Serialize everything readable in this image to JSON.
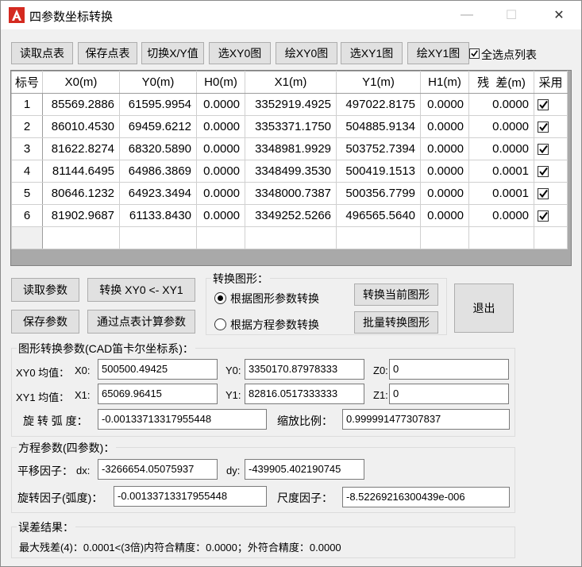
{
  "window": {
    "title": "四参数坐标转换",
    "minimize": "—",
    "maximize": "☐",
    "close": "✕"
  },
  "toolbar": {
    "read_points": "读取点表",
    "save_points": "保存点表",
    "switch_xy": "切换X/Y值",
    "select_xy0": "选XY0图",
    "draw_xy0": "绘XY0图",
    "select_xy1": "选XY1图",
    "draw_xy1": "绘XY1图",
    "select_all_label": "全选点列表",
    "select_all_checked": true
  },
  "table": {
    "columns": [
      "标号",
      "X0(m)",
      "Y0(m)",
      "H0(m)",
      "X1(m)",
      "Y1(m)",
      "H1(m)",
      "残  差(m)",
      "采用"
    ],
    "rows": [
      {
        "id": "1",
        "x0": "85569.2886",
        "y0": "61595.9954",
        "h0": "0.0000",
        "x1": "3352919.4925",
        "y1": "497022.8175",
        "h1": "0.0000",
        "res": "0.0000",
        "use": true
      },
      {
        "id": "2",
        "x0": "86010.4530",
        "y0": "69459.6212",
        "h0": "0.0000",
        "x1": "3353371.1750",
        "y1": "504885.9134",
        "h1": "0.0000",
        "res": "0.0000",
        "use": true
      },
      {
        "id": "3",
        "x0": "81622.8274",
        "y0": "68320.5890",
        "h0": "0.0000",
        "x1": "3348981.9929",
        "y1": "503752.7394",
        "h1": "0.0000",
        "res": "0.0000",
        "use": true
      },
      {
        "id": "4",
        "x0": "81144.6495",
        "y0": "64986.3869",
        "h0": "0.0000",
        "x1": "3348499.3530",
        "y1": "500419.1513",
        "h1": "0.0000",
        "res": "0.0001",
        "use": true
      },
      {
        "id": "5",
        "x0": "80646.1232",
        "y0": "64923.3494",
        "h0": "0.0000",
        "x1": "3348000.7387",
        "y1": "500356.7799",
        "h1": "0.0000",
        "res": "0.0001",
        "use": true
      },
      {
        "id": "6",
        "x0": "81902.9687",
        "y0": "61133.8430",
        "h0": "0.0000",
        "x1": "3349252.5266",
        "y1": "496565.5640",
        "h1": "0.0000",
        "res": "0.0000",
        "use": true
      }
    ]
  },
  "params_buttons": {
    "read_params": "读取参数",
    "convert": "转换 XY0 <- XY1",
    "save_params": "保存参数",
    "calc_params": "通过点表计算参数"
  },
  "convert_shape": {
    "title": "转换图形：",
    "by_shape_params": "根据图形参数转换",
    "by_equation_params": "根据方程参数转换",
    "selected": "by_shape_params",
    "convert_current": "转换当前图形",
    "batch_convert": "批量转换图形"
  },
  "exit": "退出",
  "shape_params": {
    "title": "图形转换参数(CAD笛卡尔坐标系)：",
    "xy0_mean": "XY0 均值：",
    "xy1_mean": "XY1 均值：",
    "x0_label": "X0:",
    "y0_label": "Y0:",
    "z0_label": "Z0:",
    "x1_label": "X1:",
    "y1_label": "Y1:",
    "z1_label": "Z1:",
    "x0": "500500.49425",
    "y0": "3350170.87978333",
    "z0": "0",
    "x1": "65069.96415",
    "y1": "82816.0517333333",
    "z1": "0",
    "rotation_label": "旋 转 弧 度：",
    "rotation": "-0.00133713317955448",
    "scale_label": "缩放比例：",
    "scale": "0.999991477307837"
  },
  "equation_params": {
    "title": "方程参数(四参数)：",
    "translation_label": "平移因子：",
    "dx_label": "dx:",
    "dx": "-3266654.05075937",
    "dy_label": "dy:",
    "dy": "-439905.402190745",
    "rotation_label": "旋转因子(弧度)：",
    "rotation": "-0.00133713317955448",
    "scale_label": "尺度因子：",
    "scale": "-8.52269216300439e-006"
  },
  "error_result": {
    "title": "误差结果：",
    "text": "最大残差(4)：0.0001<(3倍)内符合精度：0.0000；外符合精度：0.0000"
  },
  "colors": {
    "window_bg": "#f0f0f0",
    "titlebar_bg": "#ffffff",
    "button_bg": "#e1e1e1",
    "grid_bg": "#a9a9a9",
    "icon_red": "#d42a20"
  }
}
